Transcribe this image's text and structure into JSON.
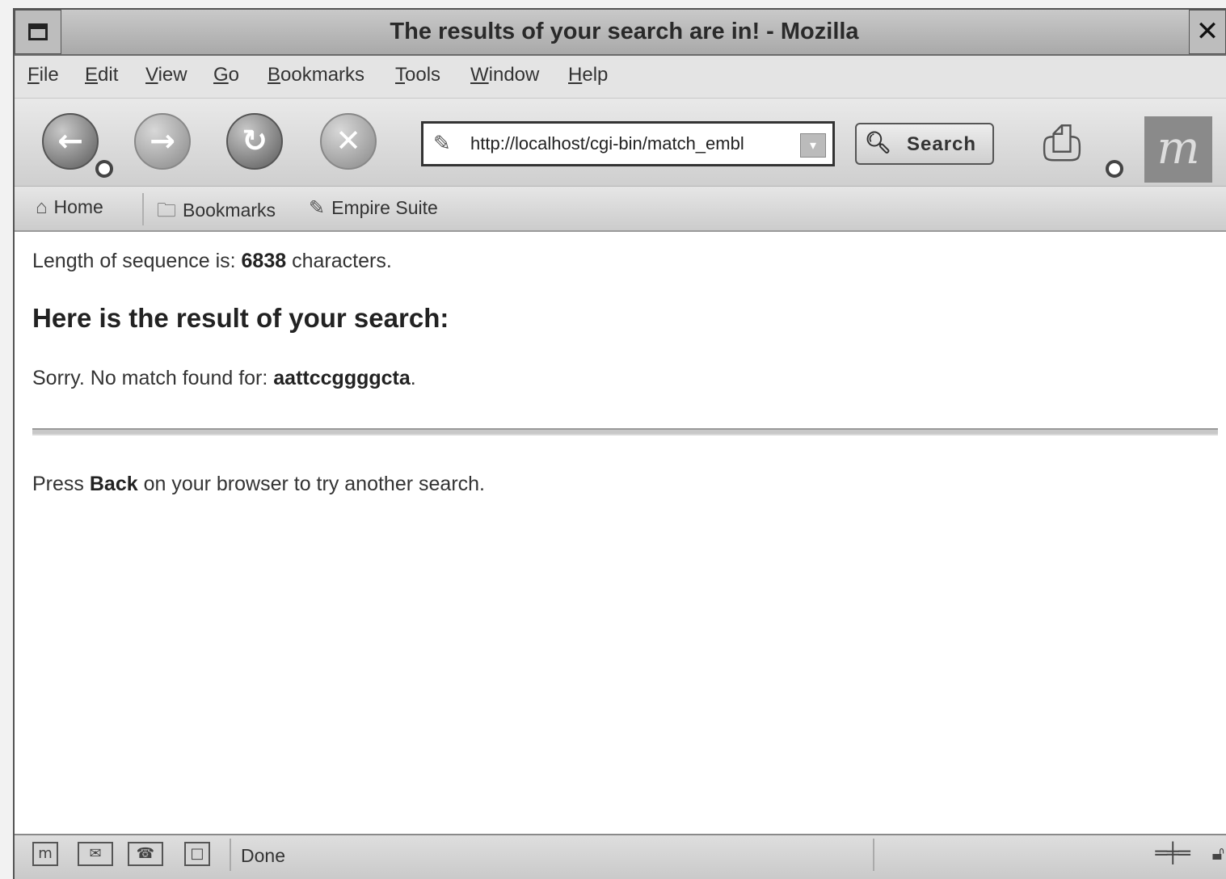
{
  "window": {
    "title": "The results of your search are in! - Mozilla",
    "close_glyph": "✕"
  },
  "menubar": {
    "items": [
      {
        "label": "File",
        "accel": "F",
        "rest": "ile"
      },
      {
        "label": "Edit",
        "accel": "E",
        "rest": "dit"
      },
      {
        "label": "View",
        "accel": "V",
        "rest": "iew"
      },
      {
        "label": "Go",
        "accel": "G",
        "rest": "o"
      },
      {
        "label": "Bookmarks",
        "accel": "B",
        "rest": "ookmarks"
      },
      {
        "label": "Tools",
        "accel": "T",
        "rest": "ools"
      },
      {
        "label": "Window",
        "accel": "W",
        "rest": "indow"
      },
      {
        "label": "Help",
        "accel": "H",
        "rest": "elp"
      }
    ]
  },
  "navbar": {
    "back_icon": "back-arrow-icon",
    "forward_icon": "forward-arrow-icon",
    "reload_icon": "reload-icon",
    "stop_icon": "stop-icon",
    "url": "http://localhost/cgi-bin/match_embl",
    "search_label": "Search"
  },
  "personal_toolbar": {
    "home_label": "Home",
    "bookmarks_label": "Bookmarks",
    "empire_label": "Empire Suite"
  },
  "content": {
    "length_prefix": "Length of sequence is: ",
    "length_value": "6838",
    "length_suffix": " characters.",
    "heading": "Here is the result of your search:",
    "nomatch_prefix": "Sorry. No match found for: ",
    "nomatch_value": "aattccggggcta",
    "nomatch_suffix": ".",
    "back_prefix": "Press ",
    "back_word": "Back",
    "back_suffix": " on your browser to try another search."
  },
  "statusbar": {
    "status_text": "Done"
  }
}
